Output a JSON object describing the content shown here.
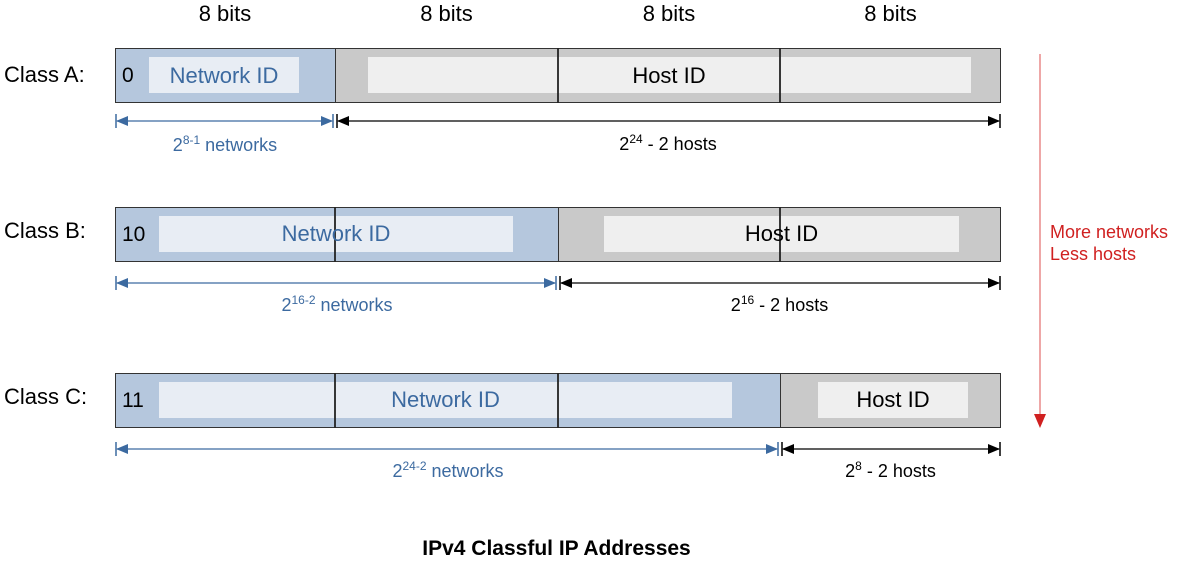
{
  "header": {
    "bit_labels": [
      "8 bits",
      "8 bits",
      "8 bits",
      "8 bits"
    ]
  },
  "classes": [
    {
      "label": "Class A:",
      "prefix": "0",
      "network_label": "Network ID",
      "host_label": "Host ID",
      "network_octets": 1,
      "networks": {
        "base": "2",
        "exp": "8-1",
        "suffix": " networks"
      },
      "hosts": {
        "base": "2",
        "exp": "24",
        "suffix": " - 2 hosts"
      }
    },
    {
      "label": "Class B:",
      "prefix": "10",
      "network_label": "Network ID",
      "host_label": "Host ID",
      "network_octets": 2,
      "networks": {
        "base": "2",
        "exp": "16-2",
        "suffix": " networks"
      },
      "hosts": {
        "base": "2",
        "exp": "16",
        "suffix": " - 2 hosts"
      }
    },
    {
      "label": "Class C:",
      "prefix": "11",
      "network_label": "Network ID",
      "host_label": "Host ID",
      "network_octets": 3,
      "networks": {
        "base": "2",
        "exp": "24-2",
        "suffix": " networks"
      },
      "hosts": {
        "base": "2",
        "exp": "8",
        "suffix": " - 2 hosts"
      }
    }
  ],
  "side_note": {
    "line1": "More networks",
    "line2": "Less hosts"
  },
  "title": "IPv4 Classful IP Addresses",
  "colors": {
    "network_fill": "#b5c7dd",
    "network_inner": "#e8edf4",
    "host_fill": "#c9c9c9",
    "host_inner": "#efefef",
    "network_text": "#3c6aa0",
    "trend_arrow": "#d02020"
  }
}
